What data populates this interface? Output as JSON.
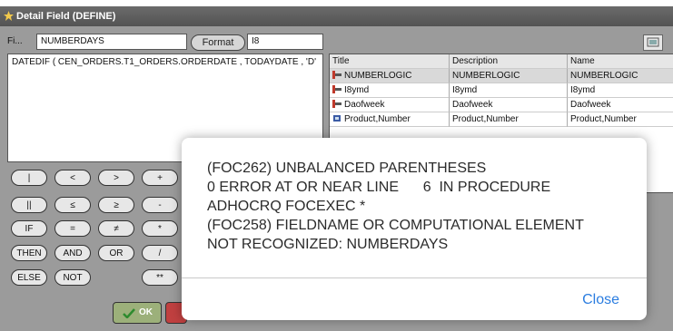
{
  "window": {
    "title": "Detail Field (DEFINE)"
  },
  "field": {
    "label": "Fi...",
    "name_value": "NUMBERDAYS",
    "format_button": "Format",
    "format_value": "I8"
  },
  "expression": "DATEDIF ( CEN_ORDERS.T1_ORDERS.ORDERDATE , TODAYDATE , 'D'",
  "columns_table": {
    "headers": [
      "Title",
      "Description",
      "Name"
    ],
    "rows": [
      {
        "title": "NUMBERLOGIC",
        "description": "NUMBERLOGIC",
        "name": "NUMBERLOGIC",
        "icon": "computed-field-icon"
      },
      {
        "title": "I8ymd",
        "description": "I8ymd",
        "name": "I8ymd",
        "icon": "computed-field-icon"
      },
      {
        "title": "Daofweek",
        "description": "Daofweek",
        "name": "Daofweek",
        "icon": "computed-field-icon"
      },
      {
        "title": "Product,Number",
        "description": "Product,Number",
        "name": "Product,Number",
        "icon": "dimension-field-icon"
      }
    ]
  },
  "operators": {
    "row1": [
      "|",
      "<",
      ">",
      "+"
    ],
    "row2": [
      "||",
      "≤",
      "≥",
      "-"
    ],
    "row3": [
      "IF",
      "=",
      "≠",
      "*"
    ],
    "row4": [
      "THEN",
      "AND",
      "OR",
      "/"
    ],
    "row5": [
      "ELSE",
      "NOT",
      "**"
    ]
  },
  "ok_button": "OK",
  "dialog": {
    "lines": [
      "(FOC262) UNBALANCED PARENTHESES",
      "0 ERROR AT OR NEAR LINE      6  IN PROCEDURE",
      "ADHOCRQ FOCEXEC *",
      "(FOC258) FIELDNAME OR COMPUTATIONAL ELEMENT",
      "NOT RECOGNIZED: NUMBERDAYS"
    ],
    "close_label": "Close"
  },
  "colors": {
    "accent_link": "#2b7de0",
    "title_bar": "#5e5e5e",
    "ok_button": "#9cb07a"
  }
}
